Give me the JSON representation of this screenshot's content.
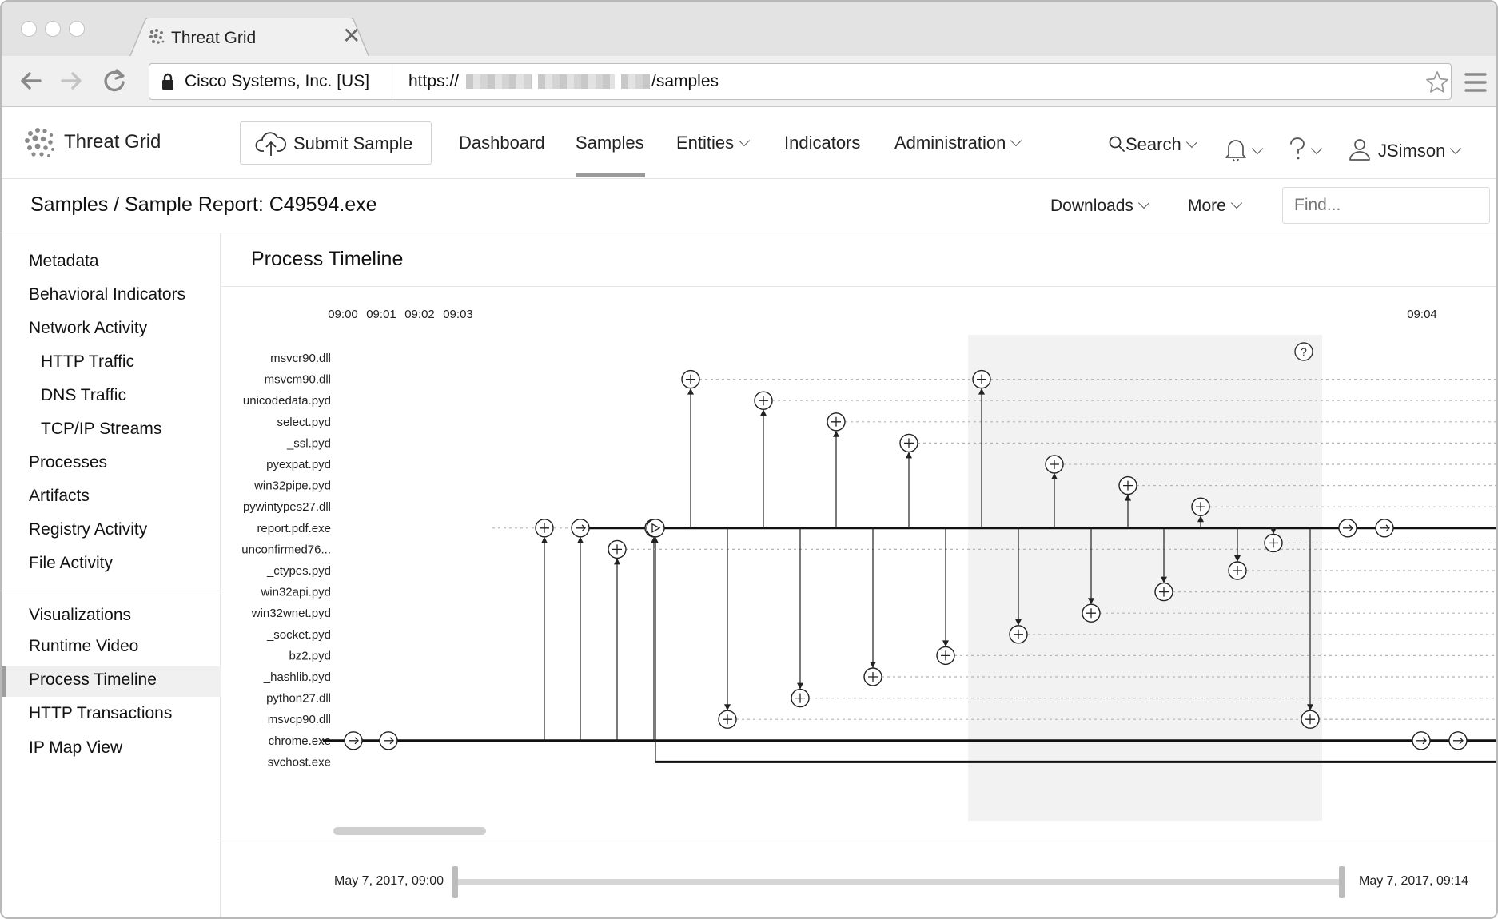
{
  "browser": {
    "tab_title": "Threat Grid",
    "tab_close": "✕",
    "cert_label": "Cisco Systems, Inc. [US]",
    "url_prefix": "https://",
    "url_suffix": "/samples"
  },
  "app": {
    "brand": "Threat Grid",
    "submit_label": "Submit Sample",
    "nav": {
      "dashboard": "Dashboard",
      "samples": "Samples",
      "entities": "Entities",
      "indicators": "Indicators",
      "administration": "Administration",
      "search": "Search",
      "user": "JSimson"
    },
    "active_nav": "Samples"
  },
  "breadcrumb": "Samples / Sample Report: C49594.exe",
  "actions": {
    "downloads": "Downloads",
    "more": "More",
    "find_placeholder": "Find..."
  },
  "sidebar": {
    "items": [
      "Metadata",
      "Behavioral Indicators",
      "Network Activity",
      "HTTP Traffic",
      "DNS Traffic",
      "TCP/IP Streams",
      "Processes",
      "Artifacts",
      "Registry Activity",
      "File Activity"
    ],
    "viz_items": [
      "Visualizations",
      "Runtime Video",
      "Process Timeline",
      "HTTP Transactions",
      "IP Map View"
    ],
    "active": "Process Timeline"
  },
  "timeline": {
    "title": "Process Timeline",
    "time_labels": [
      "09:00",
      "09:01",
      "09:02",
      "09:03",
      "09:04"
    ],
    "rows": [
      "msvcr90.dll",
      "msvcm90.dll",
      "unicodedata.pyd",
      "select.pyd",
      "_ssl.pyd",
      "pyexpat.pyd",
      "win32pipe.pyd",
      "pywintypes27.dll",
      "report.pdf.exe",
      "unconfirmed76...",
      "_ctypes.pyd",
      "win32api.pyd",
      "win32wnet.pyd",
      "_socket.pyd",
      "bz2.pyd",
      "_hashlib.pyd",
      "python27.dll",
      "msvcp90.dll",
      "chrome.exe",
      "svchost.exe"
    ],
    "help_icon": "?",
    "range_start": "May 7, 2017, 09:00",
    "range_end": "May 7, 2017, 09:14"
  }
}
